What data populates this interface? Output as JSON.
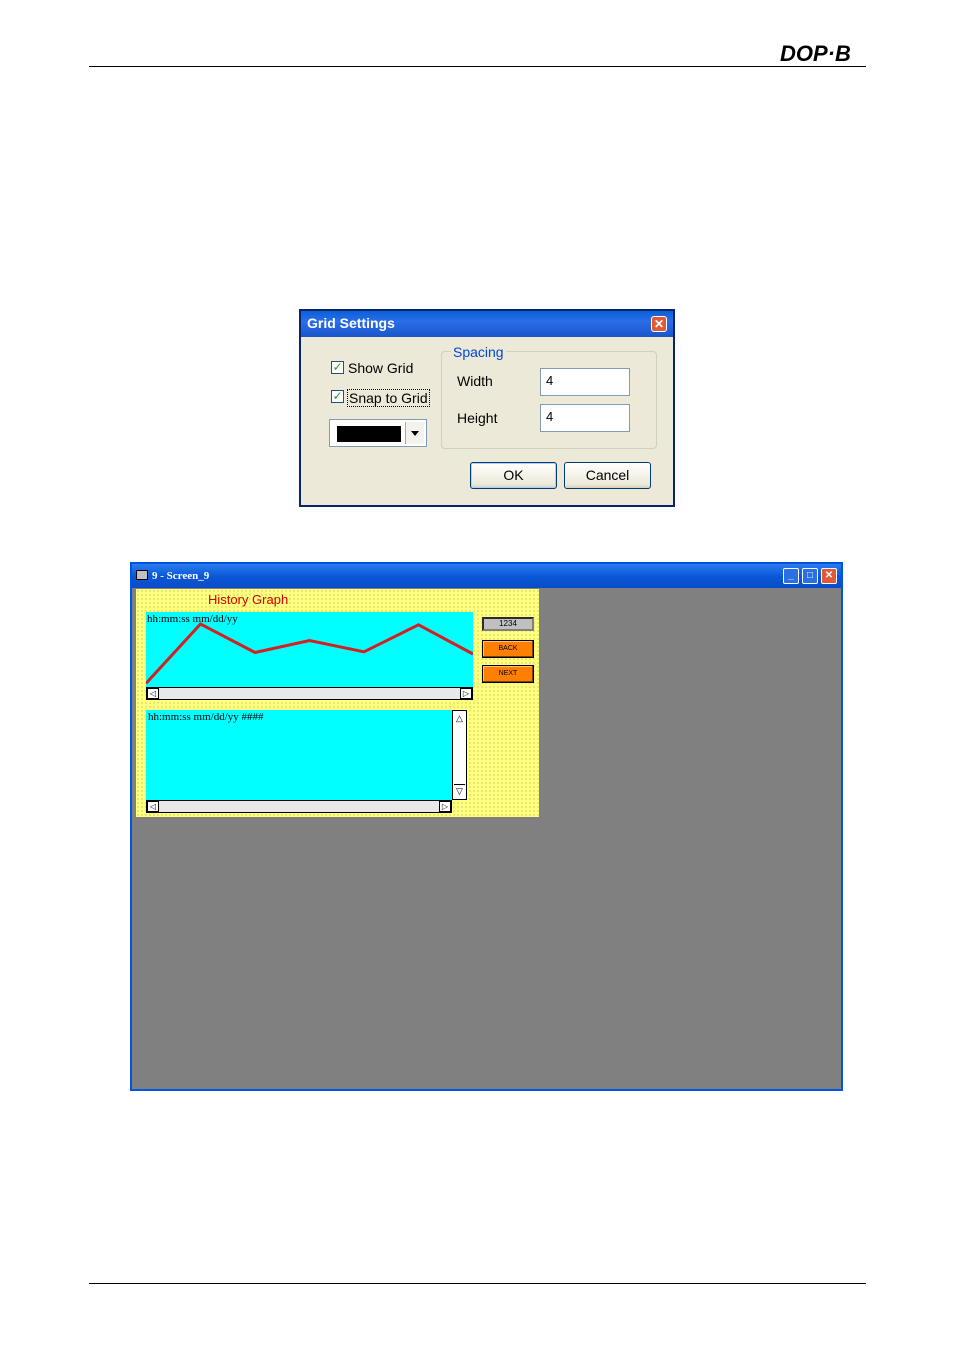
{
  "page": {
    "brand_logo_text": "DOP-B"
  },
  "grid_dialog": {
    "title": "Grid Settings",
    "show_grid": {
      "label": "Show Grid",
      "checked": true
    },
    "snap_to_grid": {
      "label": "Snap to Grid",
      "checked": true
    },
    "grid_color": "#000000",
    "spacing": {
      "group_label": "Spacing",
      "width_label": "Width",
      "width_value": "4",
      "height_label": "Height",
      "height_value": "4"
    },
    "ok_label": "OK",
    "cancel_label": "Cancel",
    "checkmark": "✓",
    "close_glyph": "✕"
  },
  "screen_window": {
    "title": "9 - Screen_9",
    "history_graph": {
      "title": "History Graph",
      "format_text": "hh:mm:ss  mm/dd/yy",
      "line_color": "#d42020",
      "trend_values": [
        5,
        84,
        46,
        62,
        47,
        83,
        44
      ]
    },
    "history_list": {
      "format_text": "hh:mm:ss  mm/dd/yy  ####"
    },
    "numeric_display": "1234",
    "back_button": "BACK",
    "next_button": "NEXT",
    "arrows": {
      "left": "◁",
      "right": "▷",
      "up": "△",
      "down": "▽"
    },
    "minimize_glyph": "_",
    "maximize_glyph": "□",
    "close_glyph": "✕"
  }
}
